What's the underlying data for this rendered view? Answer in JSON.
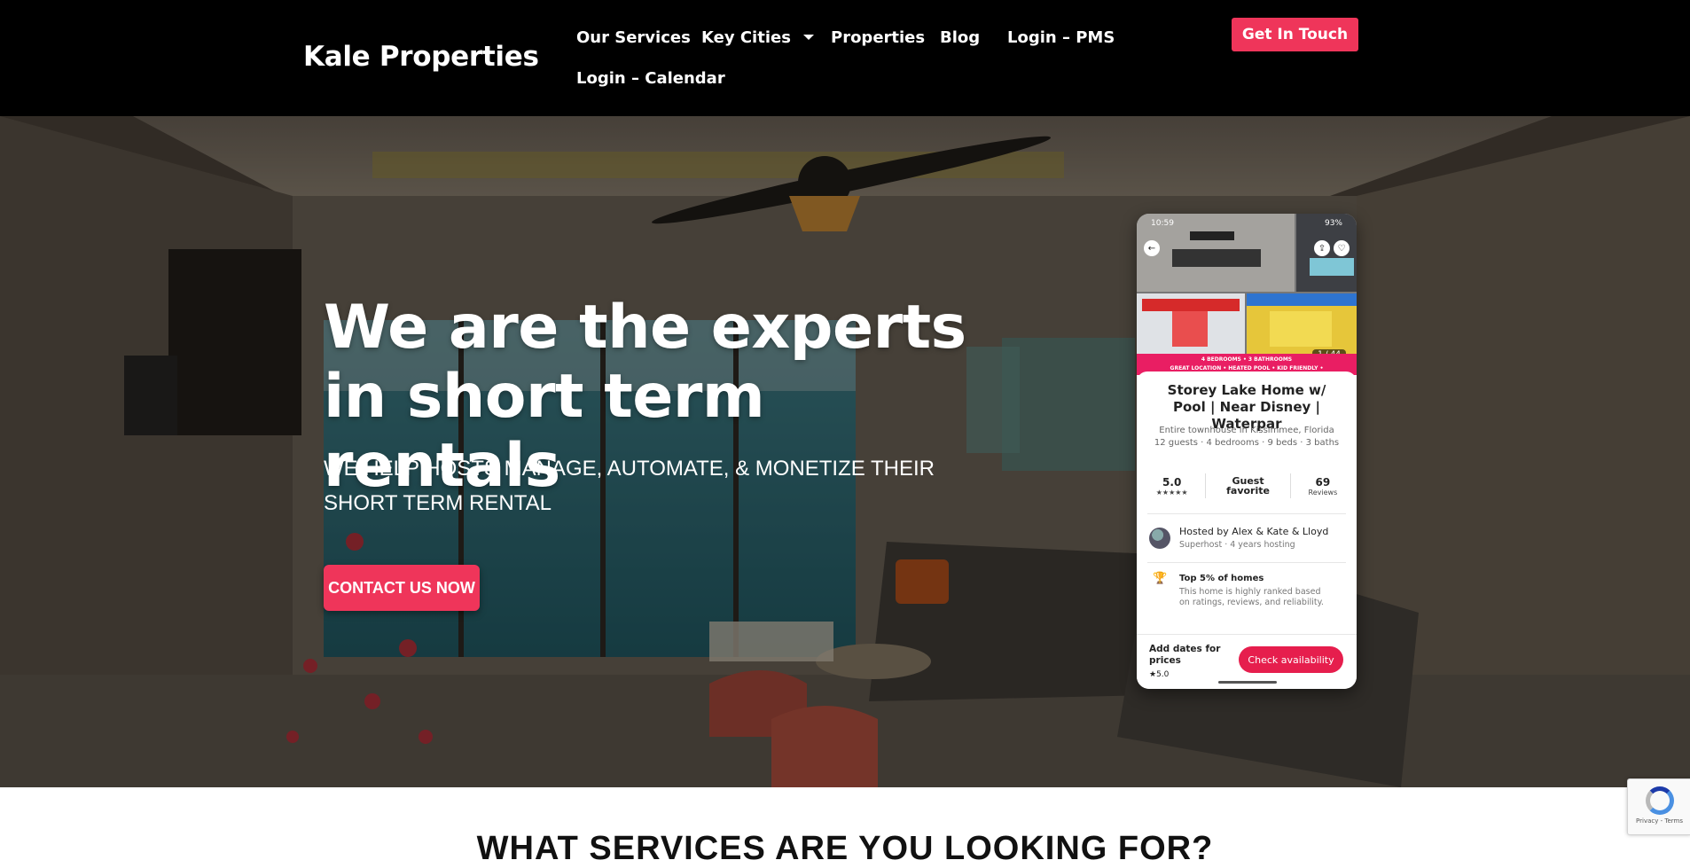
{
  "brand": "Kale Properties",
  "nav": {
    "items": [
      {
        "label": "Our Services"
      },
      {
        "label": "Key Cities",
        "has_dropdown": true
      },
      {
        "label": "Properties"
      },
      {
        "label": "Blog"
      },
      {
        "label": "Login – PMS"
      },
      {
        "label": "Login – Calendar"
      }
    ],
    "cta": "Get In Touch"
  },
  "hero": {
    "headline": "We are the experts in short term rentals",
    "subheadline": "WE HELP HOSTS MANAGE, AUTOMATE, & MONETIZE THEIR SHORT TERM RENTAL",
    "cta": "CONTACT US NOW"
  },
  "phone": {
    "status_time": "10:59",
    "status_battery": "93%",
    "banner_line1": "4 BEDROOMS • 3 BATHROOMS",
    "banner_line2": "GREAT LOCATION • HEATED POOL • KID FRIENDLY •",
    "photo_counter": "1 / 44",
    "listing_title": "Storey Lake Home w/ Pool | Near Disney | Waterpar",
    "listing_type": "Entire townhouse in Kissimmee, Florida",
    "listing_details": "12 guests · 4 bedrooms · 9 beds · 3 baths",
    "rating": "5.0",
    "rating_stars": "★★★★★",
    "guest_favorite": "Guest favorite",
    "reviews_count": "69",
    "reviews_label": "Reviews",
    "host": "Hosted by Alex & Kate & Lloyd",
    "host_meta": "Superhost · 4 years hosting",
    "top_title": "Top 5% of homes",
    "top_desc": "This home is highly ranked based on ratings, reviews, and reliability.",
    "price_prompt": "Add dates for prices",
    "footer_rating": "★5.0",
    "check_button": "Check availability"
  },
  "services_heading": "WHAT SERVICES ARE YOU LOOKING FOR?",
  "recaptcha": {
    "links": "Privacy - Terms"
  },
  "colors": {
    "accent": "#ef355a",
    "nav_bg": "#000000"
  }
}
